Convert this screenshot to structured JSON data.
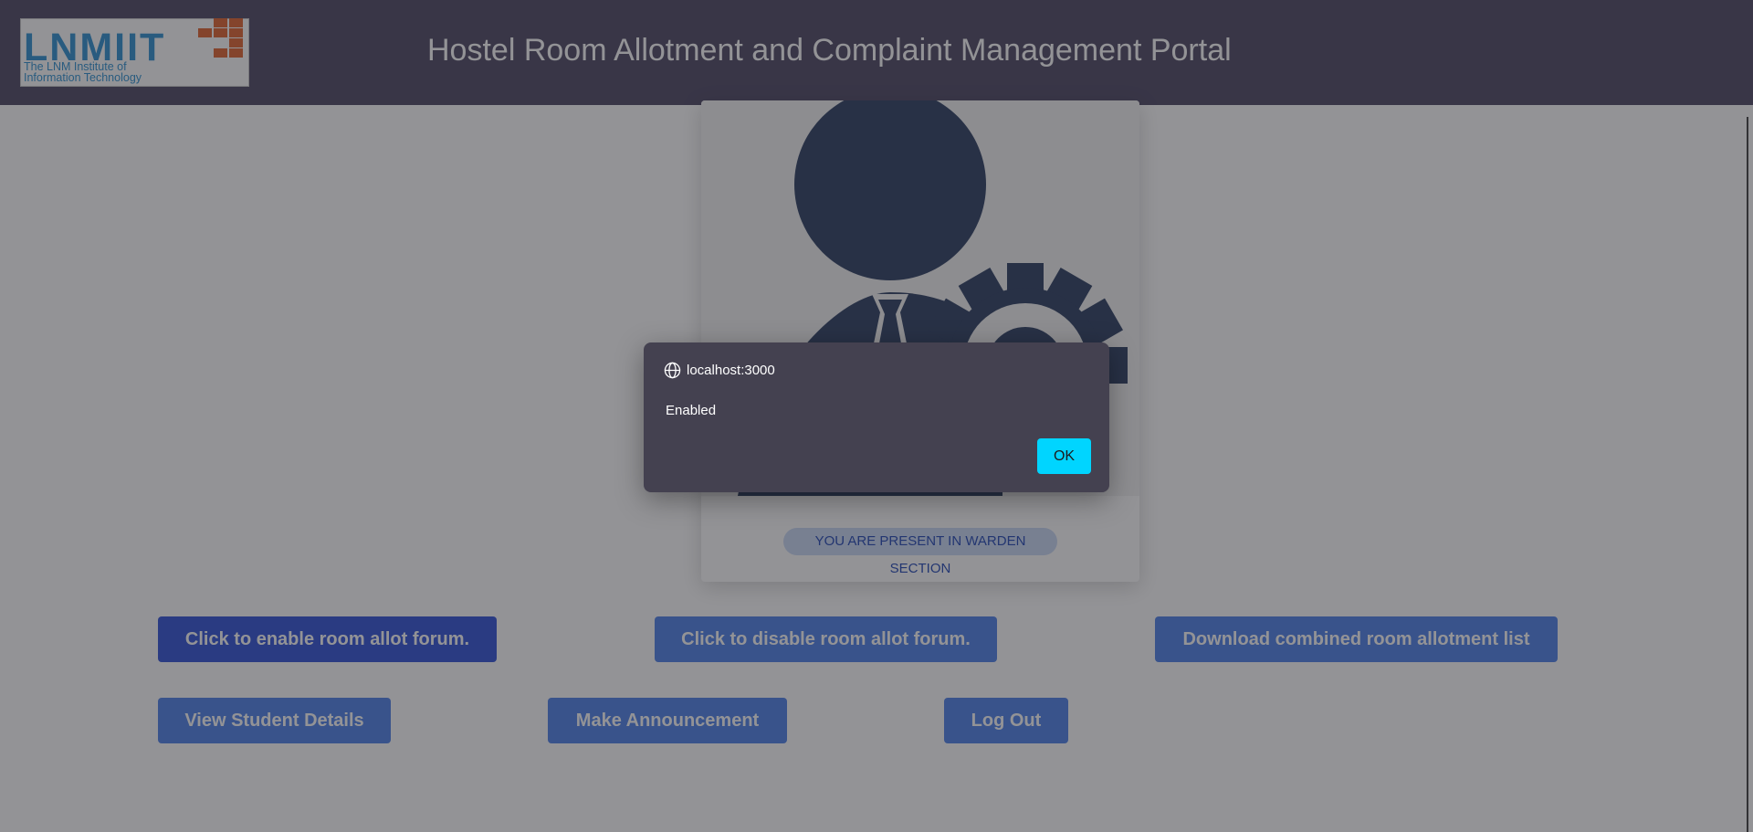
{
  "header": {
    "logo": {
      "name": "LNMIIT",
      "subtitle_line1": "The LNM Institute of",
      "subtitle_line2": "Information Technology"
    },
    "title": "Hostel Room Allotment and Complaint Management Portal"
  },
  "card": {
    "image_icon": "admin-gear-icon",
    "badge": "YOU ARE PRESENT IN WARDEN SECTION"
  },
  "actions": {
    "enable_forum": "Click to enable room allot forum.",
    "disable_forum": "Click to disable room allot forum.",
    "download_list": "Download combined room allotment list",
    "view_students": "View Student Details",
    "announcement": "Make Announcement",
    "logout": "Log Out"
  },
  "dialog": {
    "origin": "localhost:3000",
    "message": "Enabled",
    "ok_label": "OK"
  },
  "colors": {
    "header_bg": "#4a4461",
    "button_bg": "#4a7fe8",
    "button_active_bg": "#2c4fd6",
    "dialog_bg": "#444150",
    "ok_button_bg": "#00d5ff",
    "figure": "#283a5e"
  }
}
